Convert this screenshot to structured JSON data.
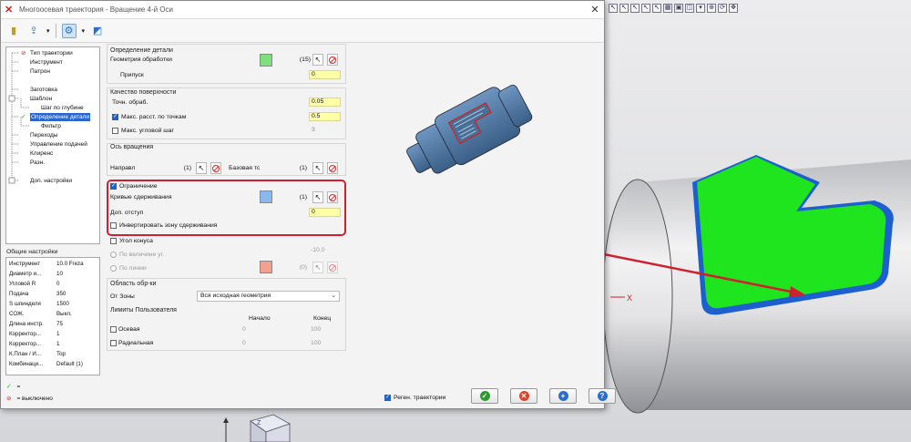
{
  "window": {
    "title": "Многоосевая траектория - Вращение 4-й Оси",
    "close_icon": "close-icon"
  },
  "toolbar": {
    "icons": [
      "tool-icon",
      "export-icon",
      "settings-icon",
      "window-icon"
    ]
  },
  "tree": {
    "items": [
      {
        "label": "Тип траектории",
        "status": "disabled"
      },
      {
        "label": "Инструмент"
      },
      {
        "label": "Патрон"
      },
      {
        "label": "Заготовка"
      },
      {
        "label": "Шаблон"
      },
      {
        "label": "Шаг по глубине"
      },
      {
        "label": "Определение детали",
        "status": "ok",
        "selected": true
      },
      {
        "label": "Фильтр"
      },
      {
        "label": "Переходы"
      },
      {
        "label": "Управление подачей"
      },
      {
        "label": "Клиренс"
      },
      {
        "label": "Разн."
      },
      {
        "label": "Доп. настройки"
      }
    ]
  },
  "general": {
    "title": "Общие настройки",
    "rows": [
      {
        "k": "Инструмент",
        "v": "10.0 Freza"
      },
      {
        "k": "Диаметр и...",
        "v": "10"
      },
      {
        "k": "Угловой R",
        "v": "0"
      },
      {
        "k": "Подача",
        "v": "350"
      },
      {
        "k": "S шпинделя",
        "v": "1500"
      },
      {
        "k": "СОЖ.",
        "v": "Выкл."
      },
      {
        "k": "Длина инстр.",
        "v": "75"
      },
      {
        "k": "Корректор...",
        "v": "1"
      },
      {
        "k": "Корректор...",
        "v": "1"
      },
      {
        "k": "К.План / И...",
        "v": "Top"
      },
      {
        "k": "Комбинаци...",
        "v": "Default (1)"
      }
    ]
  },
  "legend": {
    "ok_text": "=",
    "off_text": "= выключено"
  },
  "part_def": {
    "title": "Определение детали",
    "geometry_label": "Геометрия обработки",
    "geometry_count": "(15)",
    "geometry_color": "#7ee07a",
    "stock_label": "Припуск",
    "stock_value": "0"
  },
  "surface": {
    "title": "Качество поверхности",
    "tolerance_label": "Точн. обраб.",
    "tolerance_value": "0.05",
    "max_dist_label": "Макс. расст. по точкам",
    "max_dist_value": "0.5",
    "max_dist_checked": true,
    "max_angle_label": "Макс. угловой шаг",
    "max_angle_value": "3",
    "max_angle_checked": false
  },
  "axis": {
    "title": "Ось вращения",
    "direction_label": "Направл",
    "direction_count": "(1)",
    "base_label": "Базовая тс",
    "base_count": "(1)"
  },
  "containment": {
    "enabled_label": "Ограничение",
    "enabled_checked": true,
    "curves_label": "Кривые сдерживания",
    "curves_count": "(1)",
    "curves_color": "#8ab8f0",
    "offset_label": "Доп. отступ",
    "offset_value": "0",
    "invert_label": "Инвертировать зону сдерживания",
    "invert_checked": false
  },
  "cone": {
    "angle_label": "Угол конуса",
    "by_value_label": "По величине уг.",
    "by_value_value": "-10.0",
    "by_line_label": "По линии",
    "by_line_count": "(0)",
    "by_line_color": "#f4a090"
  },
  "area": {
    "title": "Область обр-ки",
    "from_label": "От Зоны",
    "from_value": "Вся исходная геометрия",
    "limits_title": "Лимиты Пользователя",
    "col_start": "Начало",
    "col_end": "Конец",
    "rows": [
      {
        "label": "Осевая",
        "start": "0",
        "end": "100"
      },
      {
        "label": "Радиальная",
        "start": "0",
        "end": "100"
      }
    ]
  },
  "footer": {
    "regen_label": "Реген. траектории",
    "regen_checked": true,
    "buttons": [
      "ok-icon",
      "cancel-icon",
      "add-icon",
      "help-icon"
    ]
  },
  "viewport": {
    "axis_label": "X",
    "cube_face": "Z",
    "green": "#1ee51e",
    "arrow_color": "#d02030"
  }
}
